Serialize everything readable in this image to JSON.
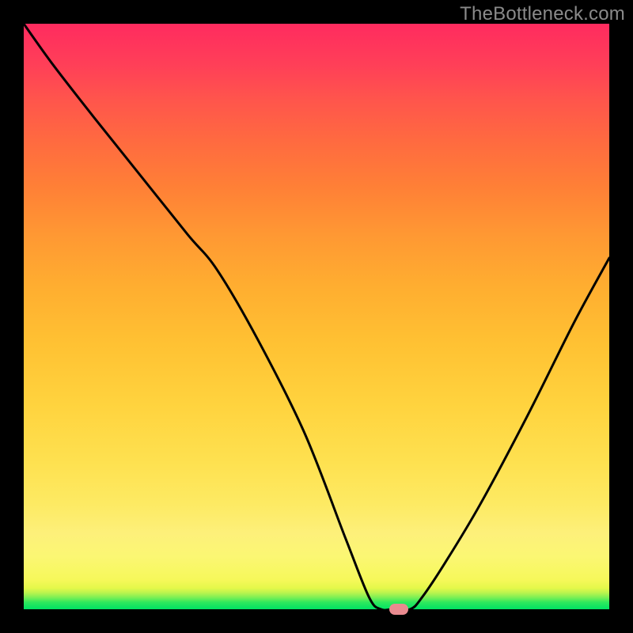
{
  "watermark": "TheBottleneck.com",
  "chart_data": {
    "type": "line",
    "title": "",
    "xlabel": "",
    "ylabel": "",
    "xlim": [
      0,
      100
    ],
    "ylim": [
      0,
      100
    ],
    "grid": false,
    "legend": false,
    "series": [
      {
        "name": "curve",
        "color": "#000000",
        "x": [
          0,
          5,
          12,
          20,
          28,
          33,
          40,
          48,
          55,
          59,
          61,
          63,
          66,
          68,
          72,
          78,
          86,
          94,
          100
        ],
        "y": [
          100,
          93,
          84,
          74,
          64,
          58,
          46,
          30,
          12,
          2,
          0,
          0,
          0,
          2,
          8,
          18,
          33,
          49,
          60
        ]
      }
    ],
    "marker": {
      "x": 64,
      "y": 0,
      "color": "#e98a8f"
    },
    "background_gradient": {
      "bottom": "#00e263",
      "mid_low": "#fdf07a",
      "mid": "#fee150",
      "mid_high": "#ff9833",
      "top": "#ff2b5f"
    }
  },
  "layout": {
    "image_size": 800,
    "plot_inset": 30,
    "plot_size": 740
  }
}
